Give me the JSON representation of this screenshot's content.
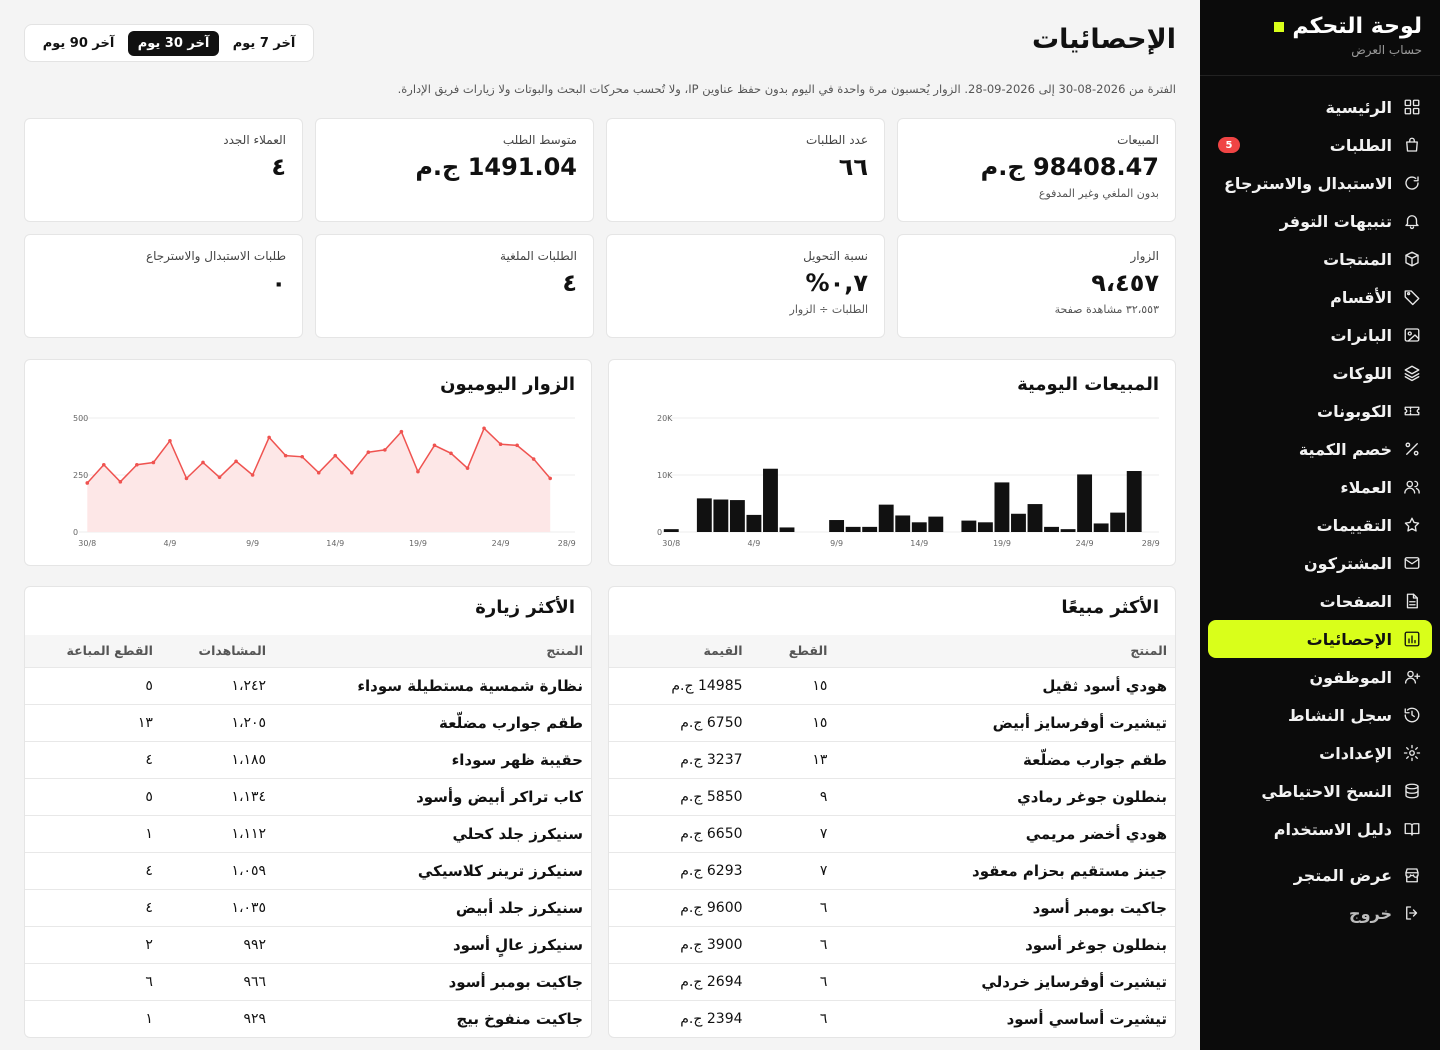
{
  "sidebar": {
    "title": "لوحة التحكم",
    "subtitle": "حساب العرض",
    "items": [
      {
        "label": "الرئيسية",
        "icon": "grid-icon"
      },
      {
        "label": "الطلبات",
        "icon": "bag-icon",
        "badge": "5"
      },
      {
        "label": "الاستبدال والاسترجاع",
        "icon": "refresh-icon"
      },
      {
        "label": "تنبيهات التوفر",
        "icon": "bell-icon"
      },
      {
        "label": "المنتجات",
        "icon": "box-icon"
      },
      {
        "label": "الأقسام",
        "icon": "tag-icon"
      },
      {
        "label": "البانرات",
        "icon": "image-icon"
      },
      {
        "label": "اللوكات",
        "icon": "layers-icon"
      },
      {
        "label": "الكوبونات",
        "icon": "ticket-icon"
      },
      {
        "label": "خصم الكمية",
        "icon": "percent-icon"
      },
      {
        "label": "العملاء",
        "icon": "users-icon"
      },
      {
        "label": "التقييمات",
        "icon": "star-icon"
      },
      {
        "label": "المشتركون",
        "icon": "mail-icon"
      },
      {
        "label": "الصفحات",
        "icon": "file-icon"
      },
      {
        "label": "الإحصائيات",
        "icon": "bar-chart-icon",
        "active": true
      },
      {
        "label": "الموظفون",
        "icon": "user-plus-icon"
      },
      {
        "label": "سجل النشاط",
        "icon": "history-icon"
      },
      {
        "label": "الإعدادات",
        "icon": "gear-icon"
      },
      {
        "label": "النسخ الاحتياطي",
        "icon": "database-icon"
      },
      {
        "label": "دليل الاستخدام",
        "icon": "book-icon"
      }
    ],
    "store_link": {
      "label": "عرض المتجر",
      "icon": "store-icon"
    },
    "logout": {
      "label": "خروج",
      "icon": "logout-icon"
    }
  },
  "header": {
    "title": "الإحصائيات",
    "ranges": [
      "آخر 7 يوم",
      "آخر 30 يوم",
      "آخر 90 يوم"
    ],
    "active_range": "آخر 30 يوم",
    "period_note": "الفترة من 2026-08-30 إلى 2026-09-28. الزوار يُحسبون مرة واحدة في اليوم بدون حفظ عناوين IP، ولا تُحسب محركات البحث والبوتات ولا زيارات فريق الإدارة."
  },
  "cards": [
    {
      "label": "المبيعات",
      "value": "98408.47 ج.م",
      "note": "بدون الملغي وغير المدفوع"
    },
    {
      "label": "عدد الطلبات",
      "value": "٦٦",
      "note": ""
    },
    {
      "label": "متوسط الطلب",
      "value": "1491.04 ج.م",
      "note": ""
    },
    {
      "label": "العملاء الجدد",
      "value": "٤",
      "note": ""
    },
    {
      "label": "الزوار",
      "value": "٩،٤٥٧",
      "note": "٣٢،٥٥٣ مشاهدة صفحة"
    },
    {
      "label": "نسبة التحويل",
      "value": "٠,٧%",
      "note": "الطلبات ÷ الزوار"
    },
    {
      "label": "الطلبات الملغية",
      "value": "٤",
      "note": ""
    },
    {
      "label": "طلبات الاستبدال والاسترجاع",
      "value": "٠",
      "note": ""
    }
  ],
  "sales_chart": {
    "title": "المبيعات اليومية",
    "chart_data": {
      "type": "bar",
      "x": [
        "30/8",
        "31/8",
        "1/9",
        "2/9",
        "3/9",
        "4/9",
        "5/9",
        "6/9",
        "7/9",
        "8/9",
        "9/9",
        "10/9",
        "11/9",
        "12/9",
        "13/9",
        "14/9",
        "15/9",
        "16/9",
        "17/9",
        "18/9",
        "19/9",
        "20/9",
        "21/9",
        "22/9",
        "23/9",
        "24/9",
        "25/9",
        "26/9",
        "27/9",
        "28/9"
      ],
      "values": [
        500,
        0,
        5900,
        5700,
        5600,
        3000,
        11100,
        800,
        0,
        0,
        2100,
        900,
        900,
        4800,
        2900,
        1700,
        2700,
        0,
        2000,
        1700,
        8700,
        3200,
        4900,
        900,
        500,
        10100,
        1500,
        3400,
        10700,
        0
      ],
      "x_ticks": [
        "30/8",
        "4/9",
        "9/9",
        "14/9",
        "19/9",
        "24/9",
        "28/9"
      ],
      "y_ticks": [
        "0",
        "10K",
        "20K"
      ],
      "ylim": [
        0,
        20000
      ]
    }
  },
  "visitors_chart": {
    "title": "الزوار اليوميون",
    "chart_data": {
      "type": "area",
      "x": [
        "30/8",
        "31/8",
        "1/9",
        "2/9",
        "3/9",
        "4/9",
        "5/9",
        "6/9",
        "7/9",
        "8/9",
        "9/9",
        "10/9",
        "11/9",
        "12/9",
        "13/9",
        "14/9",
        "15/9",
        "16/9",
        "17/9",
        "18/9",
        "19/9",
        "20/9",
        "21/9",
        "22/9",
        "23/9",
        "24/9",
        "25/9",
        "26/9",
        "27/9",
        "28/9"
      ],
      "values": [
        215,
        295,
        220,
        295,
        305,
        400,
        235,
        305,
        240,
        310,
        250,
        415,
        335,
        330,
        260,
        335,
        260,
        350,
        360,
        440,
        265,
        380,
        345,
        280,
        455,
        385,
        380,
        320,
        235,
        0
      ],
      "x_ticks": [
        "30/8",
        "4/9",
        "9/9",
        "14/9",
        "19/9",
        "24/9",
        "28/9"
      ],
      "y_ticks": [
        "0",
        "250",
        "500"
      ],
      "ylim": [
        0,
        500
      ]
    }
  },
  "top_selling": {
    "title": "الأكثر مبيعًا",
    "columns": [
      "المنتج",
      "القطع",
      "القيمة"
    ],
    "rows": [
      [
        "هودي أسود ثقيل",
        "١٥",
        "14985 ج.م"
      ],
      [
        "تيشيرت أوفرسايز أبيض",
        "١٥",
        "6750 ج.م"
      ],
      [
        "طقم جوارب مضلّعة",
        "١٣",
        "3237 ج.م"
      ],
      [
        "بنطلون جوغر رمادي",
        "٩",
        "5850 ج.م"
      ],
      [
        "هودي أخضر مريمي",
        "٧",
        "6650 ج.م"
      ],
      [
        "جينز مستقيم بحزام معقود",
        "٧",
        "6293 ج.م"
      ],
      [
        "جاكيت بومبر أسود",
        "٦",
        "9600 ج.م"
      ],
      [
        "بنطلون جوغر أسود",
        "٦",
        "3900 ج.م"
      ],
      [
        "تيشيرت أوفرسايز خردلي",
        "٦",
        "2694 ج.م"
      ],
      [
        "تيشيرت أساسي أسود",
        "٦",
        "2394 ج.م"
      ]
    ]
  },
  "top_visited": {
    "title": "الأكثر زيارة",
    "columns": [
      "المنتج",
      "المشاهدات",
      "القطع المباعة"
    ],
    "rows": [
      [
        "نظارة شمسية مستطيلة سوداء",
        "١،٢٤٢",
        "٥"
      ],
      [
        "طقم جوارب مضلّعة",
        "١،٢٠٥",
        "١٣"
      ],
      [
        "حقيبة ظهر سوداء",
        "١،١٨٥",
        "٤"
      ],
      [
        "كاب تراكر أبيض وأسود",
        "١،١٣٤",
        "٥"
      ],
      [
        "سنيكرز جلد كحلي",
        "١،١١٢",
        "١"
      ],
      [
        "سنيكرز ترينر كلاسيكي",
        "١،٠٥٩",
        "٤"
      ],
      [
        "سنيكرز جلد أبيض",
        "١،٠٣٥",
        "٤"
      ],
      [
        "سنيكرز عالٍ أسود",
        "٩٩٢",
        "٢"
      ],
      [
        "جاكيت بومبر أسود",
        "٩٦٦",
        "٦"
      ],
      [
        "جاكيت منفوخ بيج",
        "٩٢٩",
        "١"
      ]
    ]
  },
  "colors": {
    "accent": "#d9ff1a",
    "sidebar_bg": "#0b0b0b",
    "line": "#ef5350",
    "area_fill": "#fde7e7",
    "badge": "#f04444"
  }
}
